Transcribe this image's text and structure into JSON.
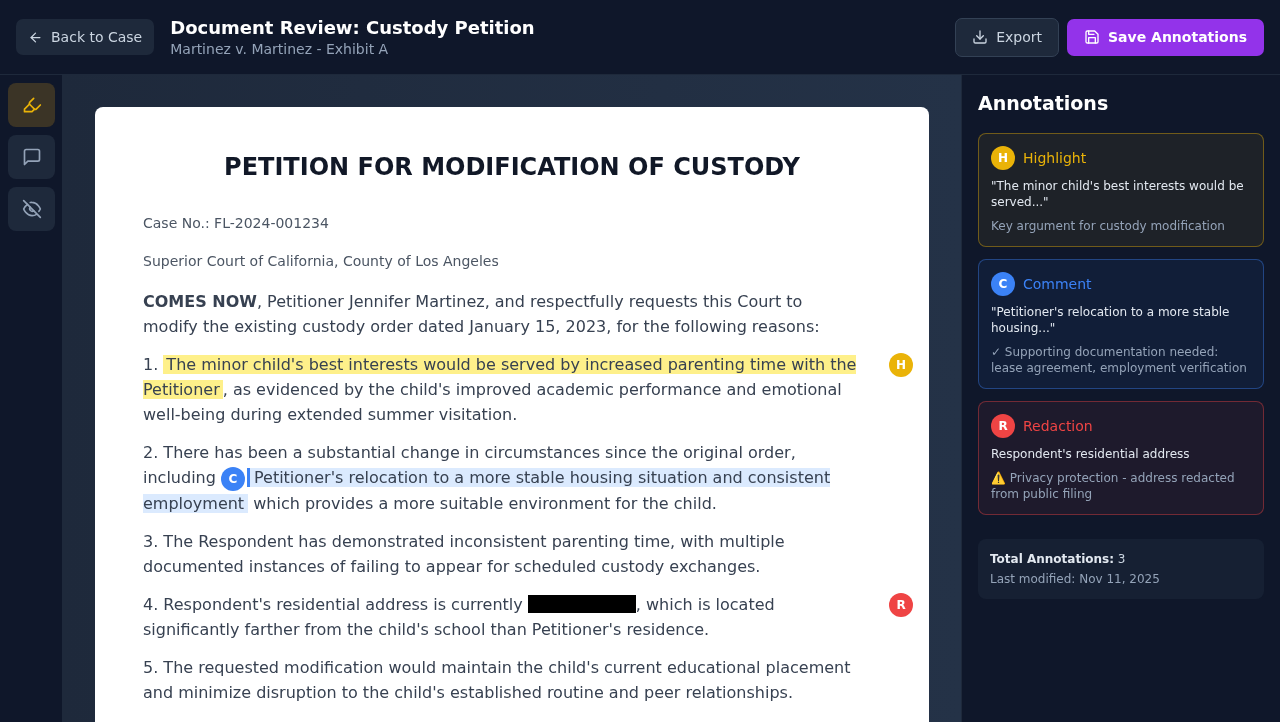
{
  "header": {
    "back_label": "Back to Case",
    "title": "Document Review: Custody Petition",
    "subtitle": "Martinez v. Martinez - Exhibit A",
    "export_label": "Export",
    "save_label": "Save Annotations"
  },
  "tools": [
    {
      "kind": "highlight",
      "selected": true
    },
    {
      "kind": "comment",
      "selected": false
    },
    {
      "kind": "hide",
      "selected": false
    }
  ],
  "document": {
    "title": "PETITION FOR MODIFICATION OF CUSTODY",
    "paragraphs": [
      {
        "kind": "meta",
        "segments": [
          {
            "kind": "text",
            "text": "Case No.: FL-2024-001234"
          }
        ]
      },
      {
        "kind": "meta",
        "segments": [
          {
            "kind": "text",
            "text": "Superior Court of California, County of Los Angeles"
          }
        ]
      },
      {
        "kind": "body",
        "segments": [
          {
            "kind": "bold",
            "text": "COMES NOW"
          },
          {
            "kind": "text",
            "text": ", Petitioner Jennifer Martinez, and respectfully requests this Court to modify the existing custody order dated January 15, 2023, for the following reasons:"
          }
        ]
      },
      {
        "kind": "body",
        "marker": {
          "letter": "H",
          "color": "#eab308",
          "kind": "margin"
        },
        "segments": [
          {
            "kind": "text",
            "text": "1. "
          },
          {
            "kind": "highlight",
            "text": "The minor child's best interests would be served by increased parenting time with the Petitioner"
          },
          {
            "kind": "text",
            "text": ", as evidenced by the child's improved academic performance and emotional well-being during extended summer visitation."
          }
        ]
      },
      {
        "kind": "body",
        "marker": {
          "letter": "C",
          "color": "#3b82f6",
          "kind": "inline"
        },
        "segments": [
          {
            "kind": "text",
            "text": "2. There has been a substantial change in circumstances since the original order, including "
          },
          {
            "kind": "comment",
            "text": "Petitioner's relocation to a more stable housing situation and consistent employment"
          },
          {
            "kind": "text",
            "text": " which provides a more suitable environment for the child."
          }
        ]
      },
      {
        "kind": "body",
        "segments": [
          {
            "kind": "text",
            "text": "3. The Respondent has demonstrated inconsistent parenting time, with multiple documented instances of failing to appear for scheduled custody exchanges."
          }
        ]
      },
      {
        "kind": "body",
        "marker": {
          "letter": "R",
          "color": "#ef4444",
          "kind": "margin"
        },
        "segments": [
          {
            "kind": "text",
            "text": "4. Respondent's residential address is currently "
          },
          {
            "kind": "redaction"
          },
          {
            "kind": "text",
            "text": ", which is located significantly farther from the child's school than Petitioner's residence."
          }
        ]
      },
      {
        "kind": "body",
        "segments": [
          {
            "kind": "text",
            "text": "5. The requested modification would maintain the child's current educational placement and minimize disruption to the child's established routine and peer relationships."
          }
        ]
      }
    ]
  },
  "panel": {
    "title": "Annotations",
    "annotations": [
      {
        "letter": "H",
        "type": "Highlight",
        "color": "#eab308",
        "quote": "\"The minor child's best interests would be served...\"",
        "note": "Key argument for custody modification"
      },
      {
        "letter": "C",
        "type": "Comment",
        "color": "#3b82f6",
        "quote": "\"Petitioner's relocation to a more stable housing...\"",
        "note": "✓ Supporting documentation needed: lease agreement, employment verification"
      },
      {
        "letter": "R",
        "type": "Redaction",
        "color": "#ef4444",
        "quote": "Respondent's residential address",
        "note": "⚠️ Privacy protection - address redacted from public filing"
      }
    ],
    "summary": {
      "total_label": "Total Annotations:",
      "total": "3",
      "modified": "Last modified: Nov 11, 2025"
    }
  }
}
